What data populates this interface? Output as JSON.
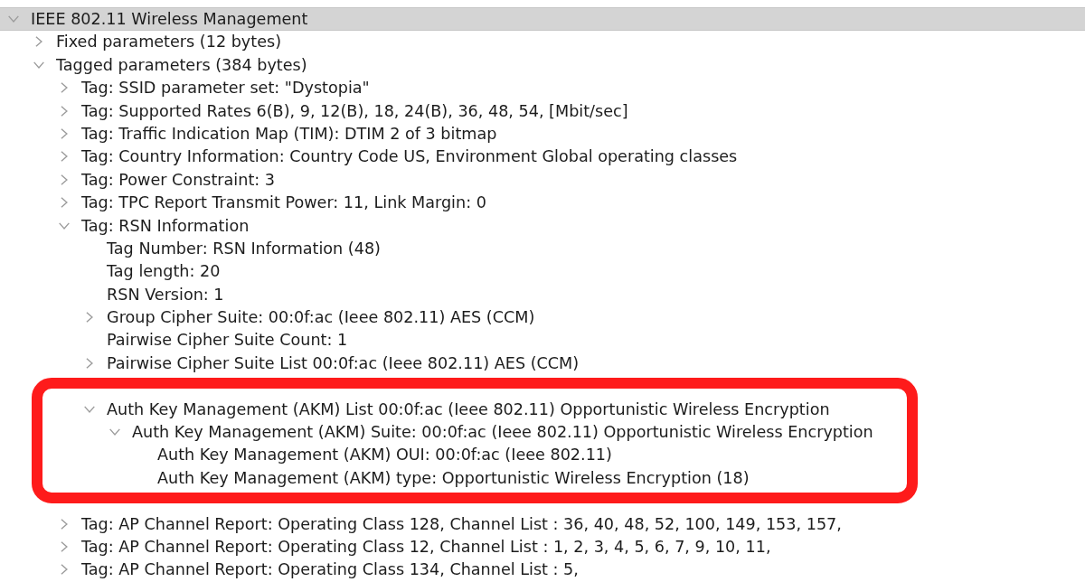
{
  "tree": [
    {
      "label": "IEEE 802.11 Wireless Management",
      "kind": "branch",
      "expanded": true,
      "selected": true,
      "highlighted": false,
      "children": [
        {
          "label": "Fixed parameters (12 bytes)",
          "kind": "branch",
          "expanded": false,
          "selected": false,
          "highlighted": false
        },
        {
          "label": "Tagged parameters (384 bytes)",
          "kind": "branch",
          "expanded": true,
          "selected": false,
          "highlighted": false,
          "children": [
            {
              "label": "Tag: SSID parameter set: \"Dystopia\"",
              "kind": "branch",
              "expanded": false,
              "selected": false,
              "highlighted": false
            },
            {
              "label": "Tag: Supported Rates 6(B), 9, 12(B), 18, 24(B), 36, 48, 54, [Mbit/sec]",
              "kind": "branch",
              "expanded": false,
              "selected": false,
              "highlighted": false
            },
            {
              "label": "Tag: Traffic Indication Map (TIM): DTIM 2 of 3 bitmap",
              "kind": "branch",
              "expanded": false,
              "selected": false,
              "highlighted": false
            },
            {
              "label": "Tag: Country Information: Country Code US, Environment Global operating classes",
              "kind": "branch",
              "expanded": false,
              "selected": false,
              "highlighted": false
            },
            {
              "label": "Tag: Power Constraint: 3",
              "kind": "branch",
              "expanded": false,
              "selected": false,
              "highlighted": false
            },
            {
              "label": "Tag: TPC Report Transmit Power: 11, Link Margin: 0",
              "kind": "branch",
              "expanded": false,
              "selected": false,
              "highlighted": false
            },
            {
              "label": "Tag: RSN Information",
              "kind": "branch",
              "expanded": true,
              "selected": false,
              "highlighted": false,
              "children": [
                {
                  "label": "Tag Number: RSN Information (48)",
                  "kind": "leaf",
                  "selected": false,
                  "highlighted": false
                },
                {
                  "label": "Tag length: 20",
                  "kind": "leaf",
                  "selected": false,
                  "highlighted": false
                },
                {
                  "label": "RSN Version: 1",
                  "kind": "leaf",
                  "selected": false,
                  "highlighted": false
                },
                {
                  "label": "Group Cipher Suite: 00:0f:ac (Ieee 802.11) AES (CCM)",
                  "kind": "branch",
                  "expanded": false,
                  "selected": false,
                  "highlighted": false
                },
                {
                  "label": "Pairwise Cipher Suite Count: 1",
                  "kind": "leaf",
                  "selected": false,
                  "highlighted": false
                },
                {
                  "label": "Pairwise Cipher Suite List 00:0f:ac (Ieee 802.11) AES (CCM)",
                  "kind": "branch",
                  "expanded": false,
                  "selected": false,
                  "highlighted": false
                },
                {
                  "label": "Auth Key Management (AKM) List 00:0f:ac (Ieee 802.11) Opportunistic Wireless Encryption",
                  "kind": "branch",
                  "expanded": true,
                  "selected": false,
                  "highlighted": true,
                  "children": [
                    {
                      "label": "Auth Key Management (AKM) Suite: 00:0f:ac (Ieee 802.11) Opportunistic Wireless Encryption",
                      "kind": "branch",
                      "expanded": true,
                      "selected": false,
                      "highlighted": false,
                      "children": [
                        {
                          "label": "Auth Key Management (AKM) OUI: 00:0f:ac (Ieee 802.11)",
                          "kind": "leaf",
                          "selected": false,
                          "highlighted": false
                        },
                        {
                          "label": "Auth Key Management (AKM) type: Opportunistic Wireless Encryption (18)",
                          "kind": "leaf",
                          "selected": false,
                          "highlighted": false
                        }
                      ]
                    }
                  ]
                }
              ]
            },
            {
              "label": "Tag: AP Channel Report: Operating Class 128, Channel List : 36, 40, 48, 52, 100, 149, 153, 157,",
              "kind": "branch",
              "expanded": false,
              "selected": false,
              "highlighted": false
            },
            {
              "label": "Tag: AP Channel Report: Operating Class 12, Channel List : 1, 2, 3, 4, 5, 6, 7, 9, 10, 11,",
              "kind": "branch",
              "expanded": false,
              "selected": false,
              "highlighted": false
            },
            {
              "label": "Tag: AP Channel Report: Operating Class 134, Channel List : 5,",
              "kind": "branch",
              "expanded": false,
              "selected": false,
              "highlighted": false
            }
          ]
        }
      ]
    }
  ]
}
